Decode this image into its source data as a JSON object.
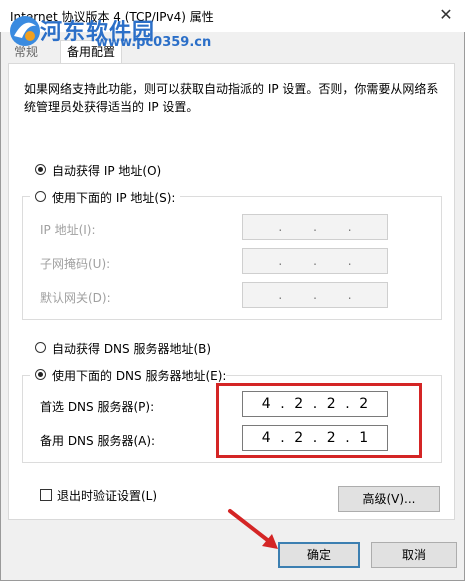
{
  "window": {
    "title": "Internet 协议版本 4 (TCP/IPv4) 属性",
    "close_symbol": "✕"
  },
  "watermark": {
    "text": "河东软件园",
    "url": "www.pc0359.cn"
  },
  "tabs": [
    {
      "label": "常规"
    },
    {
      "label": "备用配置"
    }
  ],
  "description": "如果网络支持此功能，则可以获取自动指派的 IP 设置。否则，你需要从网络系统管理员处获得适当的 IP 设置。",
  "ip_section": {
    "auto_label": "自动获得 IP 地址(O)",
    "manual_label": "使用下面的 IP 地址(S):",
    "fields": [
      {
        "label": "IP 地址(I):",
        "value": ". . ."
      },
      {
        "label": "子网掩码(U):",
        "value": ". . ."
      },
      {
        "label": "默认网关(D):",
        "value": ". . ."
      }
    ]
  },
  "dns_section": {
    "auto_label": "自动获得 DNS 服务器地址(B)",
    "manual_label": "使用下面的 DNS 服务器地址(E):",
    "preferred_label": "首选 DNS 服务器(P):",
    "preferred_octets": [
      "4",
      "2",
      "2",
      "2"
    ],
    "alternate_label": "备用 DNS 服务器(A):",
    "alternate_octets": [
      "4",
      "2",
      "2",
      "1"
    ]
  },
  "validate_label": "退出时验证设置(L)",
  "buttons": {
    "advanced": "高级(V)...",
    "ok": "确定",
    "cancel": "取消"
  },
  "colors": {
    "highlight_box": "#d42525",
    "watermark": "#2b6fc8"
  }
}
